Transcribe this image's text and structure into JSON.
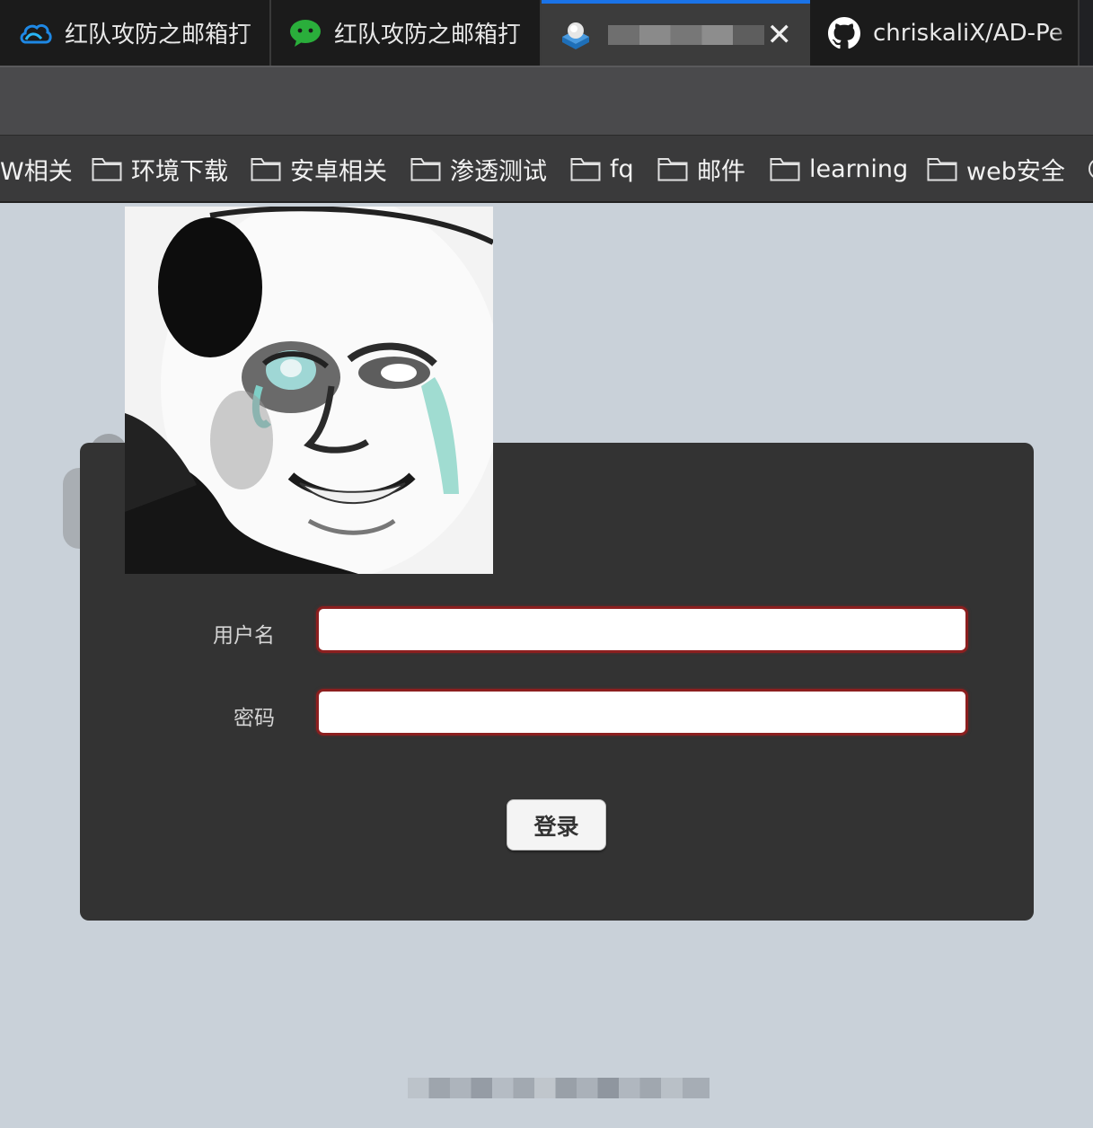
{
  "browser": {
    "tabs": [
      {
        "label": "红队攻防之邮箱打",
        "icon": "tencent-cloud-icon"
      },
      {
        "label": "红队攻防之邮箱打",
        "icon": "wechat-icon"
      },
      {
        "label": "",
        "icon": "webmail-icon",
        "active": true,
        "close": "✕"
      },
      {
        "label": "chriskaliX/AD-Pe",
        "icon": "github-icon"
      }
    ],
    "bookmarks": [
      {
        "label": "W相关",
        "folder": false
      },
      {
        "label": "环境下载",
        "folder": true
      },
      {
        "label": "安卓相关",
        "folder": true
      },
      {
        "label": "渗透测试",
        "folder": true
      },
      {
        "label": "fq",
        "folder": true
      },
      {
        "label": "邮件",
        "folder": true
      },
      {
        "label": "learning",
        "folder": true
      },
      {
        "label": "web安全",
        "folder": true
      }
    ],
    "accent": "#1a73e8"
  },
  "login": {
    "username_label": "用户名",
    "password_label": "密码",
    "username_value": "",
    "password_value": "",
    "submit_label": "登录",
    "error_border_color": "#8c1f1f"
  }
}
